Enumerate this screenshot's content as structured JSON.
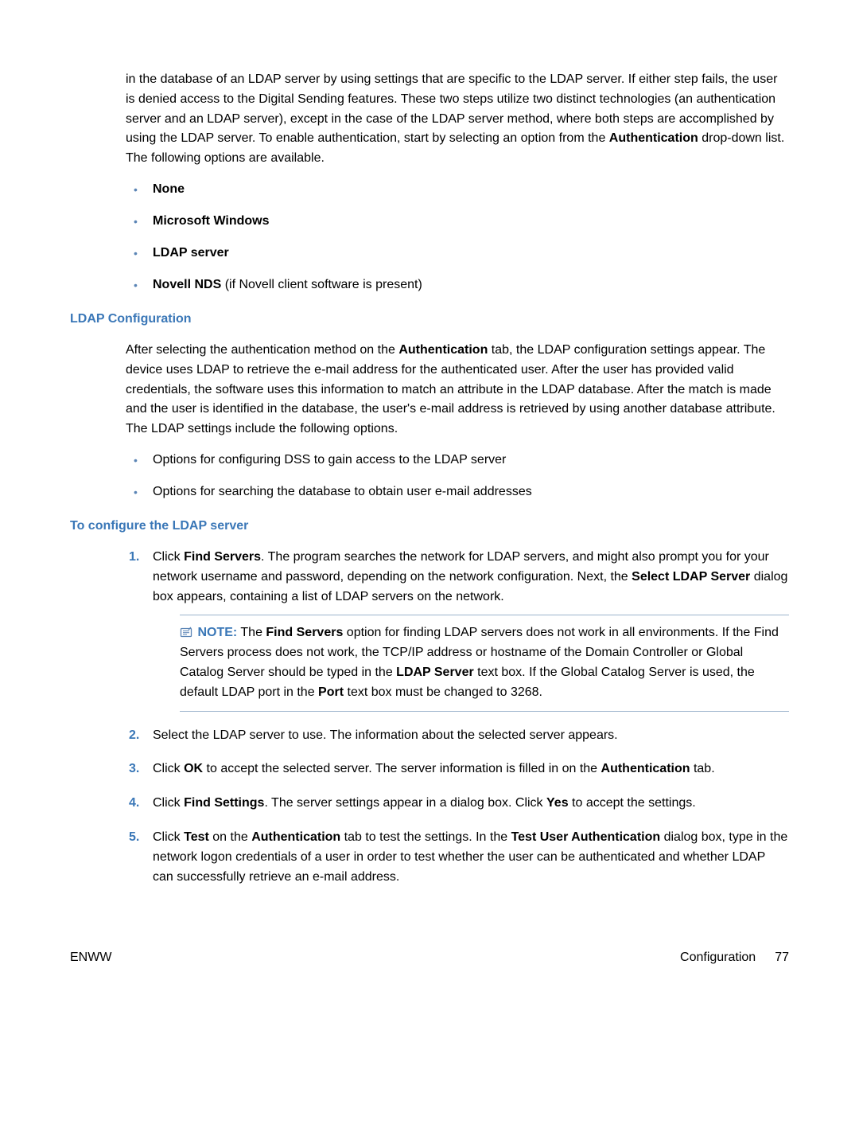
{
  "intro": {
    "para": "in the database of an LDAP server by using settings that are specific to the LDAP server. If either step fails, the user is denied access to the Digital Sending features. These two steps utilize two distinct technologies (an authentication server and an LDAP server), except in the case of the LDAP server method, where both steps are accomplished by using the LDAP server. To enable authentication, start by selecting an option from the ",
    "bold1": "Authentication",
    "after1": " drop-down list. The following options are available."
  },
  "auth_options": {
    "none": "None",
    "ms": "Microsoft Windows",
    "ldap": "LDAP server",
    "novell_bold": "Novell NDS",
    "novell_rest": " (if Novell client software is present)"
  },
  "ldap_heading": "LDAP Configuration",
  "ldap_para_pre": "After selecting the authentication method on the ",
  "ldap_para_b1": "Authentication",
  "ldap_para_mid": " tab, the LDAP configuration settings appear. The device uses LDAP to retrieve the e-mail address for the authenticated user. After the user has provided valid credentials, the software uses this information to match an attribute in the LDAP database. After the match is made and the user is identified in the database, the user's e-mail address is retrieved by using another database attribute. The LDAP settings include the following options.",
  "ldap_bullets": {
    "b1": "Options for configuring DSS to gain access to the LDAP server",
    "b2": "Options for searching the database to obtain user e-mail addresses"
  },
  "configure_heading": "To configure the LDAP server",
  "steps": {
    "s1_pre": "Click ",
    "s1_b1": "Find Servers",
    "s1_mid1": ". The program searches the network for LDAP servers, and might also prompt you for your network username and password, depending on the network configuration. Next, the ",
    "s1_b2": "Select LDAP Server",
    "s1_mid2": " dialog box appears, containing a list of LDAP servers on the network.",
    "note_label": "NOTE:",
    "note_pre": "   The ",
    "note_b1": "Find Servers",
    "note_mid1": " option for finding LDAP servers does not work in all environments. If the Find Servers process does not work, the TCP/IP address or hostname of the Domain Controller or Global Catalog Server should be typed in the ",
    "note_b2": "LDAP Server",
    "note_mid2": " text box. If the Global Catalog Server is used, the default LDAP port in the ",
    "note_b3": "Port",
    "note_mid3": " text box must be changed to 3268.",
    "s2": "Select the LDAP server to use. The information about the selected server appears.",
    "s3_pre": "Click ",
    "s3_b1": "OK",
    "s3_mid1": " to accept the selected server. The server information is filled in on the ",
    "s3_b2": "Authentication",
    "s3_mid2": " tab.",
    "s4_pre": "Click ",
    "s4_b1": "Find Settings",
    "s4_mid1": ". The server settings appear in a dialog box. Click ",
    "s4_b2": "Yes",
    "s4_mid2": " to accept the settings.",
    "s5_pre": "Click ",
    "s5_b1": "Test",
    "s5_mid1": " on the ",
    "s5_b2": "Authentication",
    "s5_mid2": " tab to test the settings. In the ",
    "s5_b3": "Test User Authentication",
    "s5_mid3": " dialog box, type in the network logon credentials of a user in order to test whether the user can be authenticated and whether LDAP can successfully retrieve an e-mail address."
  },
  "footer": {
    "left": "ENWW",
    "section": "Configuration",
    "page": "77"
  }
}
